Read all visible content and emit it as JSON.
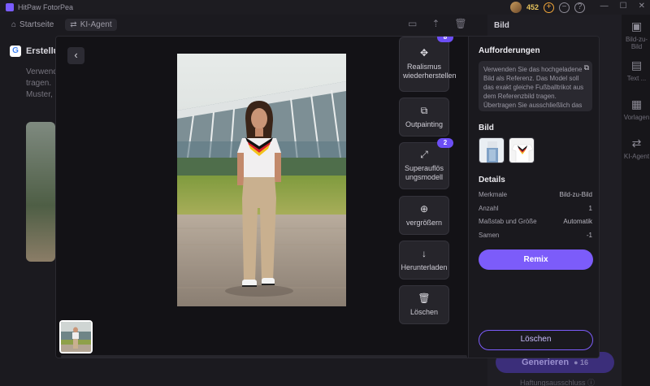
{
  "app": {
    "title": "HitPaw FotorPea",
    "credits": "452"
  },
  "nav": {
    "home_label": "Startseite",
    "agent_label": "KI-Agent"
  },
  "background": {
    "left_title": "Erstellu",
    "left_text_lines": [
      "Verwende",
      "tragen.",
      "Muster,"
    ],
    "right_panel_title": "Bild",
    "rail": {
      "item1": "Bild-zu-Bild",
      "item2": "Text ...",
      "item3": "Vorlagen",
      "item4": "KI-Agent"
    },
    "generate_label": "Generieren",
    "generate_count": "16",
    "disclaimer": "Haftungsausschluss"
  },
  "modal": {
    "actions": [
      {
        "label": "Realismus wiederherstellen",
        "icon": "move-icon",
        "badge": "8"
      },
      {
        "label": "Outpainting",
        "icon": "expand-icon",
        "badge": ""
      },
      {
        "label": "Superauflösungsmodell",
        "icon": "resize-icon",
        "badge": "2"
      },
      {
        "label": "vergrößern",
        "icon": "zoom-in-icon",
        "badge": ""
      },
      {
        "label": "Herunterladen",
        "icon": "download-icon",
        "badge": ""
      },
      {
        "label": "Löschen",
        "icon": "trash-icon",
        "badge": ""
      }
    ],
    "side": {
      "prompt_title": "Aufforderungen",
      "prompt_text": "Verwenden Sie das hochgeladene Bild als Referenz. Das Model soll das exakt gleiche Fußballtrikot aus dem Referenzbild tragen. Übertragen Sie ausschließlich das Trikot originalgetreu auf den",
      "image_title": "Bild",
      "details_title": "Details",
      "details": [
        {
          "label": "Merkmale",
          "value": "Bild-zu-Bild"
        },
        {
          "label": "Anzahl",
          "value": "1"
        },
        {
          "label": "Maßstab und Größe",
          "value": "Automatik"
        },
        {
          "label": "Samen",
          "value": "-1"
        }
      ],
      "remix_label": "Remix",
      "delete_label": "Löschen"
    }
  }
}
